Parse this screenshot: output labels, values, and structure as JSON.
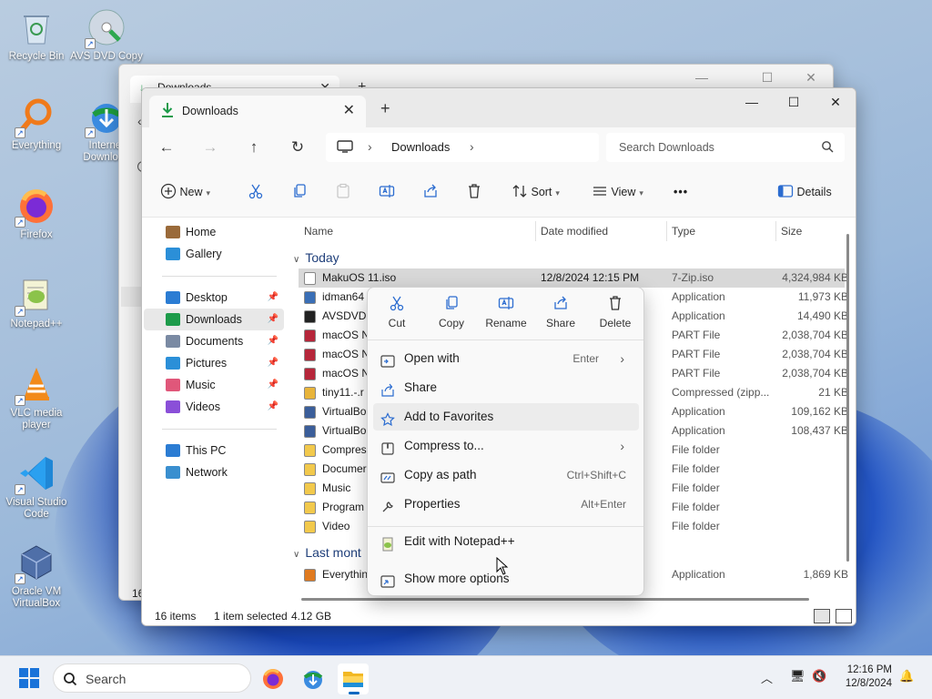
{
  "desktop": {
    "icons": [
      {
        "label": "Recycle Bin",
        "icon": "recycle-bin-icon"
      },
      {
        "label": "AVS DVD Copy",
        "icon": "avs-dvd-copy-icon"
      },
      {
        "label": "Everything",
        "icon": "everything-search-icon"
      },
      {
        "label": "Internet Download",
        "icon": "internet-download-manager-icon"
      },
      {
        "label": "Firefox",
        "icon": "firefox-icon"
      },
      {
        "label": "Notepad++",
        "icon": "notepad-plus-plus-icon"
      },
      {
        "label": "VLC media player",
        "icon": "vlc-icon"
      },
      {
        "label": "Visual Studio Code",
        "icon": "vscode-icon"
      },
      {
        "label": "Oracle VM VirtualBox",
        "icon": "virtualbox-icon"
      }
    ]
  },
  "back_window": {
    "tab_title": "Downloads",
    "count_fragment": "16"
  },
  "window": {
    "tab_title": "Downloads",
    "controls": {
      "minimize": "—",
      "maximize": "☐",
      "close": "✕"
    },
    "breadcrumb": {
      "current": "Downloads"
    },
    "search": {
      "placeholder": "Search Downloads"
    },
    "toolbar": {
      "new": "New",
      "sort": "Sort",
      "view": "View",
      "more": "•••",
      "details": "Details"
    },
    "sidebar": {
      "top": [
        {
          "label": "Home",
          "icon": "home-icon"
        },
        {
          "label": "Gallery",
          "icon": "gallery-icon"
        }
      ],
      "pinned": [
        {
          "label": "Desktop",
          "icon": "desktop-folder-icon",
          "color": "#2b7cd3"
        },
        {
          "label": "Downloads",
          "icon": "downloads-folder-icon",
          "color": "#1d9b4a"
        },
        {
          "label": "Documents",
          "icon": "documents-folder-icon",
          "color": "#7a8aa3"
        },
        {
          "label": "Pictures",
          "icon": "pictures-folder-icon",
          "color": "#2b8fd8"
        },
        {
          "label": "Music",
          "icon": "music-folder-icon",
          "color": "#e0577a"
        },
        {
          "label": "Videos",
          "icon": "videos-folder-icon",
          "color": "#8a4fd8"
        }
      ],
      "bottom": [
        {
          "label": "This PC",
          "icon": "this-pc-icon"
        },
        {
          "label": "Network",
          "icon": "network-icon"
        }
      ]
    },
    "columns": {
      "name": "Name",
      "date": "Date modified",
      "type": "Type",
      "size": "Size"
    },
    "groups": {
      "today": "Today",
      "last_month": "Last mont"
    },
    "rows_today": [
      {
        "name": "MakuOS 11.iso",
        "date": "12/8/2024 12:15 PM",
        "type": "7-Zip.iso",
        "size": "4,324,984 KB",
        "icon": "iso-file-icon",
        "color": "#ffffff",
        "selected": true
      },
      {
        "name": "idman64",
        "date": "",
        "type": "Application",
        "size": "11,973 KB",
        "icon": "idm-icon",
        "color": "#3a6fb6"
      },
      {
        "name": "AVSDVDC",
        "date": "",
        "type": "Application",
        "size": "14,490 KB",
        "icon": "avs-icon",
        "color": "#222222"
      },
      {
        "name": "macOS N",
        "date": "",
        "type": "PART File",
        "size": "2,038,704 KB",
        "icon": "part-file-icon",
        "color": "#b6263a"
      },
      {
        "name": "macOS N",
        "date": "",
        "type": "PART File",
        "size": "2,038,704 KB",
        "icon": "part-file-icon",
        "color": "#b6263a"
      },
      {
        "name": "macOS N",
        "date": "",
        "type": "PART File",
        "size": "2,038,704 KB",
        "icon": "part-file-icon",
        "color": "#b6263a"
      },
      {
        "name": "tiny11.-.r",
        "date": "",
        "type": "Compressed (zipp...",
        "size": "21 KB",
        "icon": "zip-folder-icon",
        "color": "#e8b43a"
      },
      {
        "name": "VirtualBo",
        "date": "",
        "type": "Application",
        "size": "109,162 KB",
        "icon": "virtualbox-installer-icon",
        "color": "#3b5e9a"
      },
      {
        "name": "VirtualBo",
        "date": "",
        "type": "Application",
        "size": "108,437 KB",
        "icon": "virtualbox-installer-icon",
        "color": "#3b5e9a"
      },
      {
        "name": "Compres",
        "date": "",
        "type": "File folder",
        "size": "",
        "icon": "folder-icon",
        "color": "#f2c94c"
      },
      {
        "name": "Documer",
        "date": "",
        "type": "File folder",
        "size": "",
        "icon": "folder-icon",
        "color": "#f2c94c"
      },
      {
        "name": "Music",
        "date": "",
        "type": "File folder",
        "size": "",
        "icon": "folder-icon",
        "color": "#f2c94c"
      },
      {
        "name": "Program",
        "date": "",
        "type": "File folder",
        "size": "",
        "icon": "folder-icon",
        "color": "#f2c94c"
      },
      {
        "name": "Video",
        "date": "",
        "type": "File folder",
        "size": "",
        "icon": "folder-icon",
        "color": "#f2c94c"
      }
    ],
    "rows_last_month": [
      {
        "name": "Everythin",
        "date": "",
        "type": "Application",
        "size": "1,869 KB",
        "icon": "everything-app-icon",
        "color": "#e07a1f"
      }
    ],
    "status": {
      "items": "16 items",
      "selected": "1 item selected",
      "size": "4.12 GB"
    }
  },
  "context_menu": {
    "quick_actions": [
      {
        "label": "Cut",
        "icon": "cut-icon"
      },
      {
        "label": "Copy",
        "icon": "copy-icon"
      },
      {
        "label": "Rename",
        "icon": "rename-icon"
      },
      {
        "label": "Share",
        "icon": "share-icon"
      },
      {
        "label": "Delete",
        "icon": "delete-icon"
      }
    ],
    "items": [
      {
        "label": "Open with",
        "shortcut": "Enter",
        "submenu": true,
        "icon": "open-with-icon"
      },
      {
        "label": "Share",
        "shortcut": "",
        "submenu": false,
        "icon": "share-icon"
      },
      {
        "label": "Add to Favorites",
        "shortcut": "",
        "submenu": false,
        "icon": "star-icon"
      },
      {
        "label": "Compress to...",
        "shortcut": "",
        "submenu": true,
        "icon": "compress-icon"
      },
      {
        "label": "Copy as path",
        "shortcut": "Ctrl+Shift+C",
        "submenu": false,
        "icon": "copy-path-icon"
      },
      {
        "label": "Properties",
        "shortcut": "Alt+Enter",
        "submenu": false,
        "icon": "properties-icon"
      }
    ],
    "extra_items": [
      {
        "label": "Edit with Notepad++",
        "icon": "notepad-plus-plus-icon"
      },
      {
        "label": "Show more options",
        "icon": "show-more-options-icon"
      }
    ]
  },
  "taskbar": {
    "search_placeholder": "Search",
    "apps": [
      {
        "name": "Firefox",
        "icon": "firefox-icon"
      },
      {
        "name": "Internet Download Manager",
        "icon": "internet-download-manager-icon"
      },
      {
        "name": "File Explorer",
        "icon": "file-explorer-icon",
        "active": true
      }
    ],
    "time": "12:16 PM",
    "date": "12/8/2024"
  }
}
